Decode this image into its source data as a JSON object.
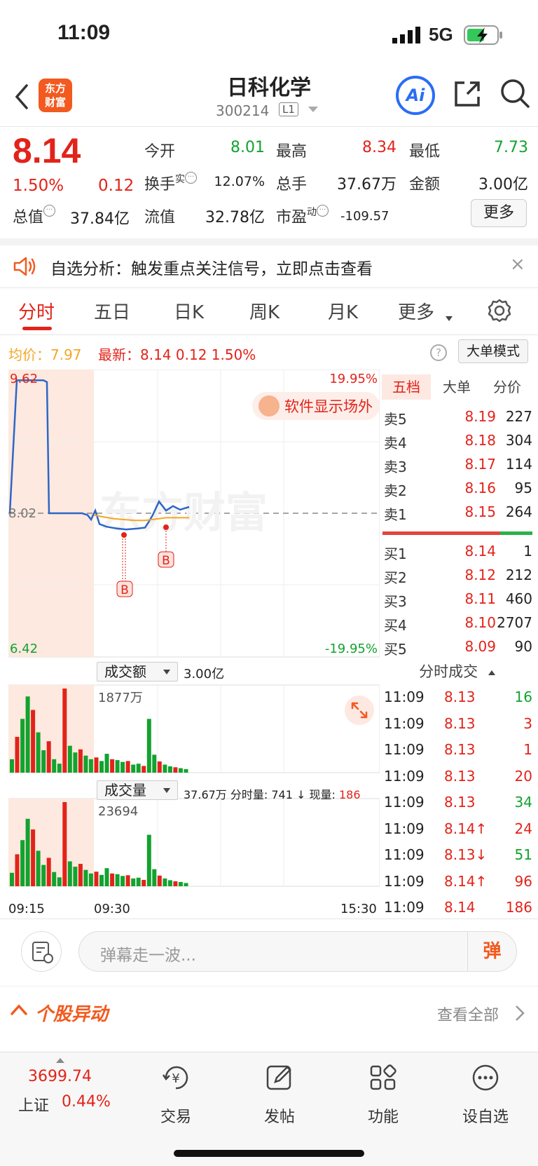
{
  "status_bar": {
    "time": "11:09",
    "network": "5G"
  },
  "header": {
    "logo_line1": "东方",
    "logo_line2": "财富",
    "stock_name": "日科化学",
    "stock_code": "300214",
    "level": "L1",
    "ai_label": "Ai"
  },
  "quote": {
    "price": "8.14",
    "change_pct": "1.50%",
    "change": "0.12",
    "market_cap_label": "总值",
    "market_cap": "37.84亿",
    "open_label": "今开",
    "open": "8.01",
    "high_label": "最高",
    "high": "8.34",
    "low_label": "最低",
    "low": "7.73",
    "turnover_label": "换手",
    "turnover_sup": "实",
    "turnover": "12.07%",
    "volume_label": "总手",
    "volume": "37.67万",
    "amount_label": "金额",
    "amount": "3.00亿",
    "float_cap_label": "流值",
    "float_cap": "32.78亿",
    "pe_label": "市盈",
    "pe_sup": "动",
    "pe": "-109.57",
    "more_label": "更多"
  },
  "notice": {
    "text": "自选分析：触发重点关注信号，立即点击查看",
    "close": "×"
  },
  "tabs": {
    "items": [
      "分时",
      "五日",
      "日K",
      "周K",
      "月K",
      "更多"
    ],
    "active": 0
  },
  "avg_line": {
    "avg_label": "均价：7.97",
    "latest_label": "最新：8.14  0.12  1.50%",
    "help": "?",
    "big_order_label": "大单模式"
  },
  "chart_labels": {
    "top_price": "9.62",
    "mid_price": "8.02",
    "bottom_price": "6.42",
    "top_pct": "19.95%",
    "bottom_pct": "-19.95%",
    "watermark": "东方财富",
    "promo": "软件显示场外",
    "signal_1": "B",
    "signal_2": "B"
  },
  "chart_data": {
    "type": "line",
    "series": [
      {
        "values": [
          8.02,
          9.5,
          9.5,
          9.48,
          8.02,
          8.02,
          8.02,
          8.0,
          7.95,
          8.05,
          7.9,
          7.87,
          7.85,
          7.84,
          7.85,
          7.86,
          7.92,
          8.0,
          8.15,
          8.05,
          8.1,
          8.06,
          8.09
        ]
      },
      {
        "values": [
          8.0,
          7.98,
          7.96,
          7.95,
          7.94,
          7.94,
          7.95,
          7.96,
          7.97,
          7.97,
          7.97,
          7.97
        ]
      }
    ],
    "ylim": [
      6.42,
      9.62
    ],
    "amount_bars_wan": [
      300,
      800,
      1200,
      1700,
      1400,
      900,
      500,
      700,
      300,
      200,
      1877,
      600,
      450,
      520,
      380,
      300,
      340,
      260,
      420,
      300,
      280,
      240,
      260,
      180,
      200,
      150,
      1200,
      400,
      250,
      180,
      140,
      120,
      100,
      80
    ],
    "volume_bars_lots": [
      3800,
      9000,
      13000,
      19000,
      16000,
      10000,
      6000,
      8000,
      4000,
      2500,
      23694,
      7000,
      5500,
      6300,
      4600,
      3600,
      4100,
      3200,
      5100,
      3600,
      3400,
      2900,
      3100,
      2200,
      2400,
      1800,
      14500,
      4800,
      3000,
      2200,
      1700,
      1400,
      1200,
      900
    ]
  },
  "order_book": {
    "tabs": [
      "五档",
      "大单",
      "分价"
    ],
    "asks": [
      {
        "label": "卖5",
        "price": "8.19",
        "vol": "227"
      },
      {
        "label": "卖4",
        "price": "8.18",
        "vol": "304"
      },
      {
        "label": "卖3",
        "price": "8.17",
        "vol": "114"
      },
      {
        "label": "卖2",
        "price": "8.16",
        "vol": "95"
      },
      {
        "label": "卖1",
        "price": "8.15",
        "vol": "264"
      }
    ],
    "bids": [
      {
        "label": "买1",
        "price": "8.14",
        "vol": "1"
      },
      {
        "label": "买2",
        "price": "8.12",
        "vol": "212"
      },
      {
        "label": "买3",
        "price": "8.11",
        "vol": "460"
      },
      {
        "label": "买4",
        "price": "8.10",
        "vol": "2707"
      },
      {
        "label": "买5",
        "price": "8.09",
        "vol": "90"
      }
    ]
  },
  "ticks": {
    "title": "分时成交",
    "rows": [
      {
        "time": "11:09",
        "price": "8.13",
        "vol": "16",
        "color": "green"
      },
      {
        "time": "11:09",
        "price": "8.13",
        "vol": "3",
        "color": "red"
      },
      {
        "time": "11:09",
        "price": "8.13",
        "vol": "1",
        "color": "red"
      },
      {
        "time": "11:09",
        "price": "8.13",
        "vol": "20",
        "color": "red"
      },
      {
        "time": "11:09",
        "price": "8.13",
        "vol": "34",
        "color": "green"
      },
      {
        "time": "11:09",
        "price": "8.14↑",
        "vol": "24",
        "color": "red"
      },
      {
        "time": "11:09",
        "price": "8.13↓",
        "vol": "51",
        "color": "green"
      },
      {
        "time": "11:09",
        "price": "8.14↑",
        "vol": "96",
        "color": "red"
      },
      {
        "time": "11:09",
        "price": "8.14",
        "vol": "186",
        "color": "red"
      }
    ]
  },
  "sub_charts": {
    "amount_label": "成交额",
    "amount_value": "3.00亿",
    "amount_max": "1877万",
    "volume_label": "成交量",
    "volume_info": "37.67万 分时量: 741 ↓ 现量: ",
    "volume_now": "186",
    "volume_max": "23694",
    "time_start": "09:15",
    "time_mid": "09:30",
    "time_end": "15:30"
  },
  "danmu": {
    "placeholder": "弹幕走一波...",
    "button": "弹"
  },
  "movers": {
    "title": "个股异动",
    "view_all": "查看全部"
  },
  "bottom_nav": {
    "index_value": "3699.74",
    "index_name": "上证",
    "index_pct": "0.44%",
    "items": [
      "交易",
      "发帖",
      "功能",
      "设自选"
    ]
  }
}
